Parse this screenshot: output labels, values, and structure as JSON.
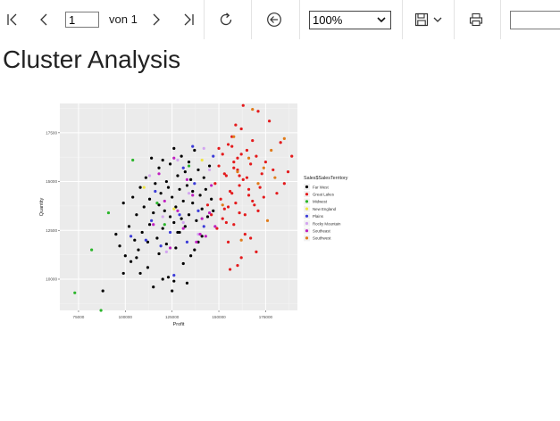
{
  "toolbar": {
    "page_current": "1",
    "page_of": "von 1",
    "zoom": "100%",
    "find_placeholder": ""
  },
  "report": {
    "title": "Cluster Analysis"
  },
  "chart_data": {
    "type": "scatter",
    "title": "",
    "xlabel": "Profit",
    "ylabel": "Quantity",
    "xlim": [
      65000,
      192000
    ],
    "ylim": [
      8400,
      19000
    ],
    "x_ticks": [
      75000,
      100000,
      125000,
      150000,
      175000
    ],
    "x_tick_labels": [
      "75000",
      "100000",
      "125000",
      "150000",
      "175000"
    ],
    "y_ticks": [
      10000,
      12500,
      15000,
      17500
    ],
    "y_tick_labels": [
      "10000",
      "12500",
      "15000",
      "17500"
    ],
    "grid": true,
    "background": "#ebebeb",
    "legend": {
      "title": "Sales$SalesTerritory",
      "placement": "right"
    },
    "series": [
      {
        "name": "Far West",
        "color": "#000000",
        "x": [
          88000,
          95000,
          97000,
          99000,
          100000,
          102000,
          103000,
          104000,
          105000,
          106000,
          107000,
          108000,
          109000,
          110000,
          111000,
          112000,
          113000,
          113000,
          114000,
          115000,
          116000,
          117000,
          118000,
          118000,
          119000,
          120000,
          120000,
          121000,
          122000,
          122000,
          123000,
          124000,
          124000,
          125000,
          126000,
          126000,
          127000,
          128000,
          128000,
          129000,
          130000,
          130000,
          131000,
          132000,
          132000,
          133000,
          134000,
          134000,
          135000,
          136000,
          136000,
          137000,
          138000,
          139000,
          140000,
          141000,
          142000,
          143000,
          144000,
          145000,
          146000,
          147000,
          99000,
          106000,
          112000,
          118000,
          123000,
          127000,
          131000,
          135000,
          139000,
          133000,
          125000,
          115000,
          108000,
          120000,
          126000,
          137000,
          141000,
          129000
        ],
        "y": [
          9400,
          12300,
          11700,
          13900,
          11200,
          12700,
          10900,
          14200,
          12000,
          13300,
          11500,
          14700,
          12400,
          13700,
          15200,
          11900,
          14100,
          12800,
          16200,
          13400,
          14900,
          12100,
          15700,
          13800,
          14400,
          12600,
          16100,
          13500,
          15000,
          11800,
          14700,
          13200,
          15900,
          14200,
          12900,
          16700,
          13700,
          15300,
          12400,
          14600,
          13100,
          16300,
          14000,
          15500,
          12700,
          14800,
          13300,
          16000,
          15100,
          13900,
          14500,
          16600,
          13000,
          15600,
          14300,
          13600,
          15200,
          14600,
          13200,
          15800,
          14100,
          13500,
          10300,
          11100,
          10600,
          11300,
          10100,
          11600,
          10800,
          11200,
          11900,
          9800,
          9400,
          9600,
          10300,
          10000,
          9900,
          11500,
          12200,
          12400
        ]
      },
      {
        "name": "Great Lakes",
        "color": "#e41a1c",
        "x": [
          148000,
          150000,
          151000,
          152000,
          153000,
          154000,
          155000,
          156000,
          157000,
          158000,
          159000,
          160000,
          161000,
          162000,
          163000,
          164000,
          165000,
          166000,
          167000,
          168000,
          169000,
          170000,
          171000,
          172000,
          173000,
          175000,
          177000,
          179000,
          181000,
          183000,
          185000,
          187000,
          189000,
          149000,
          152000,
          155000,
          158000,
          161000,
          164000,
          167000,
          170000,
          156000,
          160000,
          154000,
          162000,
          158000,
          168000,
          153000,
          157000,
          163000,
          146000,
          144000,
          159000,
          165000,
          150000,
          166000,
          171000,
          174000,
          160000,
          162000,
          157000,
          155000,
          161000
        ],
        "y": [
          14900,
          15800,
          14100,
          16400,
          13600,
          15300,
          16900,
          14500,
          17300,
          15700,
          13900,
          16200,
          14800,
          17700,
          15100,
          13300,
          16600,
          14300,
          15900,
          17100,
          13800,
          16300,
          18600,
          14700,
          15400,
          16000,
          18100,
          15600,
          14400,
          17000,
          14900,
          15500,
          16300,
          12600,
          13100,
          11900,
          12800,
          13400,
          12300,
          12100,
          11400,
          10500,
          10700,
          12900,
          11100,
          16000,
          14000,
          15400,
          16800,
          18900,
          13300,
          13800,
          17900,
          15200,
          16700,
          14600,
          13500,
          14200,
          15600,
          16400,
          14400,
          13700,
          15300
        ]
      },
      {
        "name": "Midwest",
        "color": "#2ab52a",
        "x": [
          73000,
          82000,
          91000,
          87000,
          117000,
          104000,
          121000,
          134000
        ],
        "y": [
          9300,
          11500,
          13400,
          8400,
          13900,
          16100,
          12800,
          15800
        ]
      },
      {
        "name": "New England",
        "color": "#f0e442",
        "x": [
          110000,
          126000,
          141000
        ],
        "y": [
          14700,
          13600,
          16100
        ]
      },
      {
        "name": "Plains",
        "color": "#3c3cd8",
        "x": [
          103000,
          114000,
          119000,
          124000,
          129000,
          131000,
          133000,
          137000,
          139000,
          142000,
          126000,
          116000,
          136000,
          147000,
          111000
        ],
        "y": [
          12200,
          13000,
          11700,
          12400,
          13300,
          15700,
          11900,
          14900,
          13500,
          12700,
          10200,
          14500,
          16800,
          16300,
          12000
        ]
      },
      {
        "name": "Rocky Mountain",
        "color": "#d3a5f0",
        "x": [
          113000,
          120000,
          128000,
          134000,
          139000,
          145000,
          122000,
          131000,
          142000
        ],
        "y": [
          15300,
          13200,
          16100,
          14400,
          12300,
          15600,
          11400,
          12900,
          16700
        ]
      },
      {
        "name": "Southeast",
        "color": "#c020c0",
        "x": [
          115000,
          121000,
          124000,
          128000,
          131000,
          136000,
          138000,
          141000,
          143000,
          146000,
          133000,
          126000,
          118000,
          140000,
          145000,
          148000
        ],
        "y": [
          12800,
          14000,
          11600,
          13500,
          12600,
          14300,
          11900,
          13100,
          12200,
          14800,
          15100,
          16200,
          15400,
          12300,
          13400,
          12700
        ]
      },
      {
        "name": "Southwest",
        "color": "#e07b1a",
        "x": [
          152000,
          160000,
          166000,
          171000,
          178000,
          180000,
          185000,
          176000,
          168000,
          162000,
          174000,
          158000
        ],
        "y": [
          13800,
          15500,
          16200,
          14900,
          16600,
          15200,
          17200,
          13000,
          18700,
          12000,
          15700,
          17300
        ]
      }
    ]
  }
}
